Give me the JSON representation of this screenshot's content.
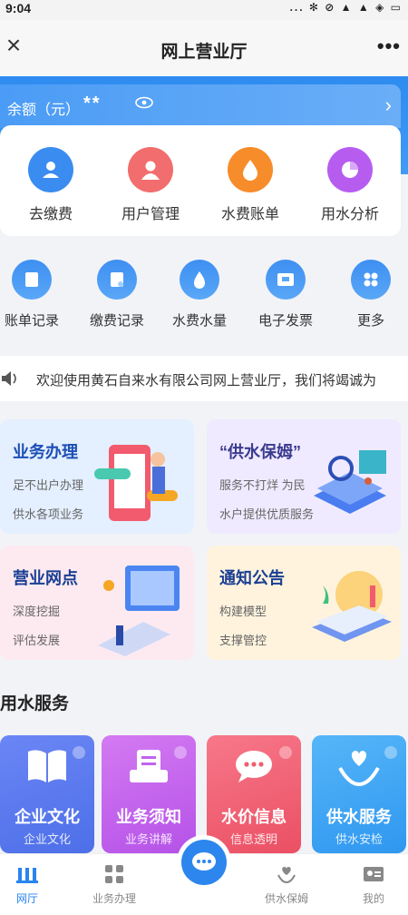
{
  "status_bar": {
    "time": "9:04",
    "icons": "... ✻ ⊘ ▲ ▲ ◈ ▭"
  },
  "nav": {
    "title": "网上营业厅",
    "close_glyph": "×",
    "more_glyph": "•••"
  },
  "balance": {
    "label": "余额（元）",
    "value": "**",
    "arrow": "›"
  },
  "main_actions": [
    {
      "label": "去缴费",
      "color": "#3a8cf0",
      "icon": "payment-icon"
    },
    {
      "label": "用户管理",
      "color": "#f26d6d",
      "icon": "user-icon"
    },
    {
      "label": "水费账单",
      "color": "#f78c2a",
      "icon": "water-bill-icon"
    },
    {
      "label": "用水分析",
      "color": "#b65df0",
      "icon": "pie-chart-icon"
    }
  ],
  "secondary_actions": [
    {
      "label": "账单记录",
      "icon": "bill-record-icon"
    },
    {
      "label": "缴费记录",
      "icon": "payment-record-icon"
    },
    {
      "label": "水费水量",
      "icon": "water-drop-icon"
    },
    {
      "label": "电子发票",
      "icon": "invoice-icon"
    },
    {
      "label": "更多",
      "icon": "more-grid-icon"
    }
  ],
  "notice": {
    "text": "欢迎使用黄石自来水有限公司网上营业厅，我们将竭诚为"
  },
  "tiles": [
    {
      "title": "业务办理",
      "line1": "足不出户办理",
      "line2": "供水各项业务"
    },
    {
      "title": "“供水保姆”",
      "line1": "服务不打烊 为民",
      "line2": "水户提供优质服务"
    },
    {
      "title": "营业网点",
      "line1": "深度挖掘",
      "line2": "评估发展"
    },
    {
      "title": "通知公告",
      "line1": "构建模型",
      "line2": "支撑管控"
    }
  ],
  "section": {
    "title": "用水服务"
  },
  "services": [
    {
      "title": "企业文化",
      "subtitle": "企业文化"
    },
    {
      "title": "业务须知",
      "subtitle": "业务讲解"
    },
    {
      "title": "水价信息",
      "subtitle": "信息透明"
    },
    {
      "title": "供水服务",
      "subtitle": "供水安检"
    }
  ],
  "tabs": [
    {
      "label": "网厅",
      "icon": "home-hall-icon"
    },
    {
      "label": "业务办理",
      "icon": "business-icon"
    },
    {
      "label": "供水保姆",
      "icon": "heart-hand-icon"
    },
    {
      "label": "我的",
      "icon": "profile-card-icon"
    }
  ],
  "colors": {
    "primary": "#2d86ee",
    "tile_business": "#e4efff",
    "tile_nanny": "#efeaff",
    "tile_outlets": "#fdeaf0",
    "tile_notice": "#fff3dd",
    "svc_culture": "#5b7ff2",
    "svc_notice": "#c263ee",
    "svc_price": "#f05e6e",
    "svc_supply": "#3aa3f5"
  }
}
